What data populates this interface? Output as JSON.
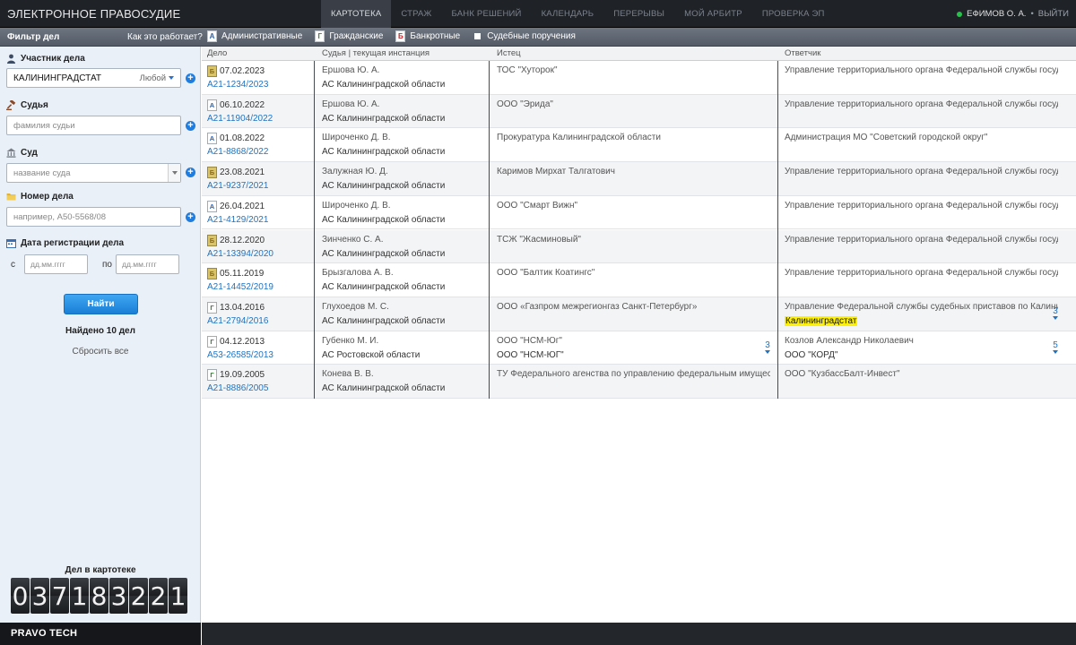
{
  "app": {
    "brand": "ЭЛЕКТРОННОЕ ПРАВОСУДИЕ"
  },
  "nav": [
    {
      "label": "КАРТОТЕКА",
      "active": true
    },
    {
      "label": "СТРАЖ",
      "active": false
    },
    {
      "label": "БАНК РЕШЕНИЙ",
      "active": false
    },
    {
      "label": "КАЛЕНДАРЬ",
      "active": false
    },
    {
      "label": "ПЕРЕРЫВЫ",
      "active": false
    },
    {
      "label": "МОЙ АРБИТР",
      "active": false
    },
    {
      "label": "ПРОВЕРКА ЭП",
      "active": false
    }
  ],
  "user": {
    "name": "ЕФИМОВ О. А.",
    "separator": "•",
    "logout": "ВЫЙТИ"
  },
  "subbar": {
    "filter_title": "Фильтр дел",
    "how_it_works": "Как это работает?",
    "types": [
      {
        "icon": "А",
        "label": "Административные"
      },
      {
        "icon": "Г",
        "label": "Гражданские"
      },
      {
        "icon": "Б",
        "label": "Банкротные"
      },
      {
        "icon": "",
        "label": "Судебные поручения"
      }
    ]
  },
  "filter": {
    "participant": {
      "label": "Участник дела",
      "value": "КАЛИНИНГРАДСТАТ",
      "role": "Любой"
    },
    "judge": {
      "label": "Судья",
      "placeholder": "фамилия судьи"
    },
    "court": {
      "label": "Суд",
      "placeholder": "название суда"
    },
    "case_number": {
      "label": "Номер дела",
      "placeholder": "например, А50-5568/08"
    },
    "reg_date": {
      "label": "Дата регистрации дела",
      "from_label": "с",
      "to_label": "по",
      "from_placeholder": "дд.мм.гггг",
      "to_placeholder": "дд.мм.гггг"
    },
    "find_button": "Найти",
    "found_text": "Найдено 10 дел",
    "reset": "Сбросить все"
  },
  "counter": {
    "title": "Дел в картотеке",
    "digits": [
      "0",
      "3",
      "7",
      "1",
      "8",
      "3",
      "2",
      "2",
      "1"
    ]
  },
  "footer": {
    "logo": "PRAVO TECH"
  },
  "table": {
    "headers": [
      "Дело",
      "Судья | текущая инстанция",
      "Истец",
      "Ответчик"
    ],
    "rows": [
      {
        "type": "Б",
        "date": "07.02.2023",
        "number": "А21-1234/2023",
        "judge": "Ершова Ю. А.",
        "court": "АС Калининградской области",
        "plaintiff": [
          "ТОС \"Хуторок\""
        ],
        "plaintiff_more": "",
        "respondent": [
          "Управление территориального органа Федеральной службы государственн"
        ],
        "respondent_more": ""
      },
      {
        "type": "А",
        "date": "06.10.2022",
        "number": "А21-11904/2022",
        "judge": "Ершова Ю. А.",
        "court": "АС Калининградской области",
        "plaintiff": [
          "ООО \"Эрида\""
        ],
        "plaintiff_more": "",
        "respondent": [
          "Управление территориального органа Федеральной службы государственн"
        ],
        "respondent_more": ""
      },
      {
        "type": "А",
        "date": "01.08.2022",
        "number": "А21-8868/2022",
        "judge": "Широченко Д. В.",
        "court": "АС Калининградской области",
        "plaintiff": [
          "Прокуратура Калининградской области"
        ],
        "plaintiff_more": "",
        "respondent": [
          "Администрация МО \"Советский городской округ\""
        ],
        "respondent_more": ""
      },
      {
        "type": "Б",
        "date": "23.08.2021",
        "number": "А21-9237/2021",
        "judge": "Залужная Ю. Д.",
        "court": "АС Калининградской области",
        "plaintiff": [
          "Каримов Мирхат Талгатович"
        ],
        "plaintiff_more": "",
        "respondent": [
          "Управление территориального органа Федеральной службы государственн"
        ],
        "respondent_more": ""
      },
      {
        "type": "А",
        "date": "26.04.2021",
        "number": "А21-4129/2021",
        "judge": "Широченко Д. В.",
        "court": "АС Калининградской области",
        "plaintiff": [
          "ООО \"Смарт Вижн\""
        ],
        "plaintiff_more": "",
        "respondent": [
          "Управление территориального органа Федеральной службы государственн"
        ],
        "respondent_more": ""
      },
      {
        "type": "Б",
        "date": "28.12.2020",
        "number": "А21-13394/2020",
        "judge": "Зинченко С. А.",
        "court": "АС Калининградской области",
        "plaintiff": [
          "ТСЖ \"Жасминовый\""
        ],
        "plaintiff_more": "",
        "respondent": [
          "Управление территориального органа Федеральной службы государственн"
        ],
        "respondent_more": ""
      },
      {
        "type": "Б",
        "date": "05.11.2019",
        "number": "А21-14452/2019",
        "judge": "Брызгалова А. В.",
        "court": "АС Калининградской области",
        "plaintiff": [
          "ООО \"Балтик Коатингс\""
        ],
        "plaintiff_more": "",
        "respondent": [
          "Управление территориального органа Федеральной службы государственн"
        ],
        "respondent_more": ""
      },
      {
        "type": "Г",
        "date": "13.04.2016",
        "number": "А21-2794/2016",
        "judge": "Глухоедов М. С.",
        "court": "АС Калининградской области",
        "plaintiff": [
          "ООО «Газпром межрегионгаз Санкт-Петербург»"
        ],
        "plaintiff_more": "",
        "respondent": [
          "Управление Федеральной службы судебных приставов по Калининградс",
          "Калининградстат"
        ],
        "respondent_more": "3"
      },
      {
        "type": "Г",
        "date": "04.12.2013",
        "number": "А53-26585/2013",
        "judge": "Губенко М. И.",
        "court": "АС Ростовской области",
        "plaintiff": [
          "ООО \"НСМ-Юг\"",
          "ООО \"НСМ-ЮГ\""
        ],
        "plaintiff_more": "3",
        "respondent": [
          "Козлов Александр Николаевич",
          "ООО \"КОРД\""
        ],
        "respondent_more": "5"
      },
      {
        "type": "Г",
        "date": "19.09.2005",
        "number": "А21-8886/2005",
        "judge": "Конева В. В.",
        "court": "АС Калининградской области",
        "plaintiff": [
          "ТУ Федерального агенства по управлению федеральным имуществом"
        ],
        "plaintiff_more": "",
        "respondent": [
          "ООО \"КузбассБалт-Инвест\""
        ],
        "respondent_more": ""
      }
    ]
  },
  "colors": {
    "accent": "#1f73c2",
    "highlight": "#fff200",
    "sidebar_bg": "#e9f0f8",
    "topbar_bg": "#1f2227"
  }
}
